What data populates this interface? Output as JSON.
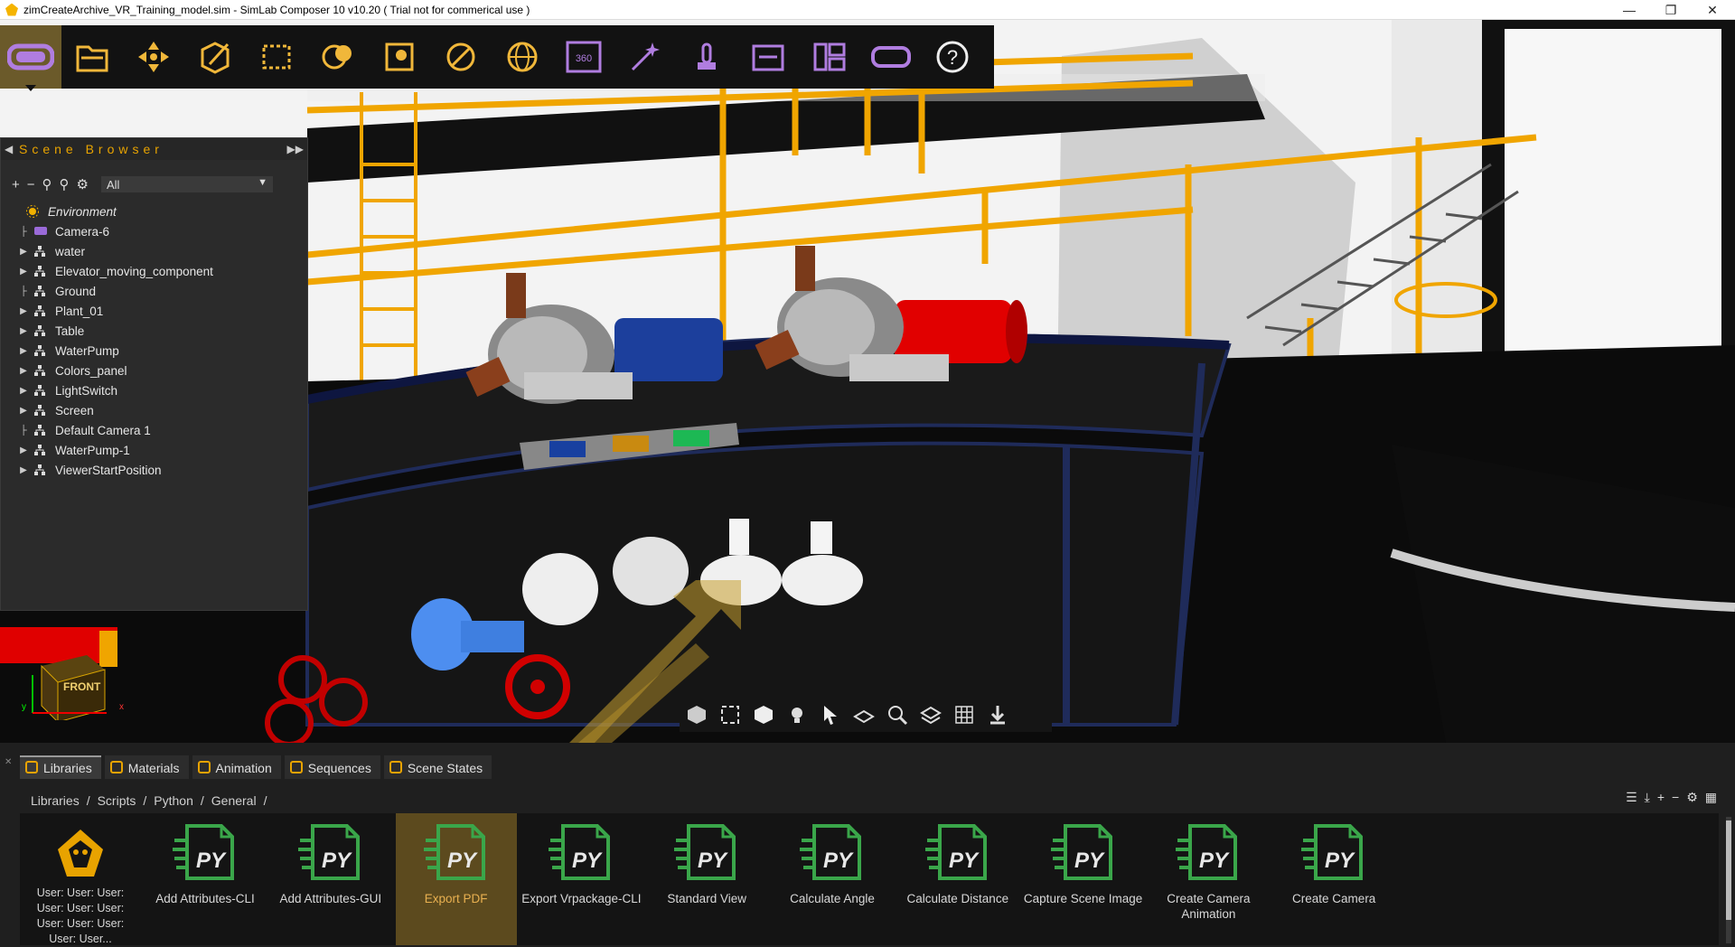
{
  "window": {
    "title": "zimCreateArchive_VR_Training_model.sim - SimLab Composer 10 v10.20 ( Trial not for commerical use )",
    "controls": [
      "minimize",
      "maximize",
      "close"
    ]
  },
  "toolbar": {
    "icons": [
      "vr-headset-icon",
      "open-folder-icon",
      "transform-icon",
      "edit-box-icon",
      "selection-box-icon",
      "materials-icon",
      "render-icon",
      "lighting-icon",
      "globe-icon",
      "360-icon",
      "effects-wand-icon",
      "interaction-icon",
      "sequence-icon",
      "layout-icon",
      "vr-viewer-icon",
      "help-icon"
    ],
    "vr360_text": "360",
    "help_text": "?"
  },
  "scene_browser": {
    "title": "Scene Browser",
    "filter": "All",
    "tools": [
      "+",
      "−"
    ],
    "items": [
      {
        "label": "Environment",
        "icon": "sun-icon",
        "expandable": false
      },
      {
        "label": "Camera-6",
        "icon": "camera-icon",
        "expandable": false
      },
      {
        "label": "water",
        "icon": "hierarchy-icon",
        "expandable": true
      },
      {
        "label": "Elevator_moving_component",
        "icon": "hierarchy-icon",
        "expandable": true
      },
      {
        "label": "Ground",
        "icon": "hierarchy-icon",
        "expandable": false
      },
      {
        "label": "Plant_01",
        "icon": "hierarchy-icon",
        "expandable": true
      },
      {
        "label": "Table",
        "icon": "hierarchy-icon",
        "expandable": true
      },
      {
        "label": "WaterPump",
        "icon": "hierarchy-icon",
        "expandable": true
      },
      {
        "label": "Colors_panel",
        "icon": "hierarchy-icon",
        "expandable": true
      },
      {
        "label": "LightSwitch",
        "icon": "hierarchy-icon",
        "expandable": true
      },
      {
        "label": "Screen",
        "icon": "hierarchy-icon",
        "expandable": true
      },
      {
        "label": "Default Camera 1",
        "icon": "hierarchy-icon",
        "expandable": false
      },
      {
        "label": "WaterPump-1",
        "icon": "hierarchy-icon",
        "expandable": true
      },
      {
        "label": "ViewerStartPosition",
        "icon": "hierarchy-icon",
        "expandable": true
      }
    ]
  },
  "viewport": {
    "nav_cube_label": "FRONT",
    "axis_labels": {
      "x": "x",
      "y": "y"
    }
  },
  "bottom_panel": {
    "tabs": [
      {
        "label": "Libraries",
        "icon": "library-icon",
        "active": true
      },
      {
        "label": "Materials",
        "icon": "materials-icon",
        "active": false
      },
      {
        "label": "Animation",
        "icon": "animation-icon",
        "active": false
      },
      {
        "label": "Sequences",
        "icon": "sequences-icon",
        "active": false
      },
      {
        "label": "Scene States",
        "icon": "scene-states-icon",
        "active": false
      }
    ],
    "breadcrumb": [
      "Libraries",
      "/",
      "Scripts",
      "/",
      "Python",
      "/",
      "General",
      "/"
    ],
    "items": [
      {
        "label": "User: User: User: User: User: User: User: User: User: User: User...",
        "icon": "dragon-logo-icon"
      },
      {
        "label": "Add Attributes-CLI",
        "icon": "python-script-icon"
      },
      {
        "label": "Add Attributes-GUI",
        "icon": "python-script-icon"
      },
      {
        "label": "Export PDF",
        "icon": "python-script-icon",
        "selected": true
      },
      {
        "label": "Export Vrpackage-CLI",
        "icon": "python-script-icon"
      },
      {
        "label": "Standard View",
        "icon": "python-script-icon"
      },
      {
        "label": "Calculate Angle",
        "icon": "python-script-icon"
      },
      {
        "label": "Calculate Distance",
        "icon": "python-script-icon"
      },
      {
        "label": "Capture Scene Image",
        "icon": "python-script-icon"
      },
      {
        "label": "Create Camera Animation",
        "icon": "python-script-icon"
      },
      {
        "label": "Create Camera",
        "icon": "python-script-icon"
      }
    ],
    "py_text": "PY"
  },
  "colors": {
    "accent": "#e8a300",
    "toolbar_icon": "#f0b73a",
    "purple_icon": "#b07de0",
    "py_green": "#3aa64a"
  }
}
